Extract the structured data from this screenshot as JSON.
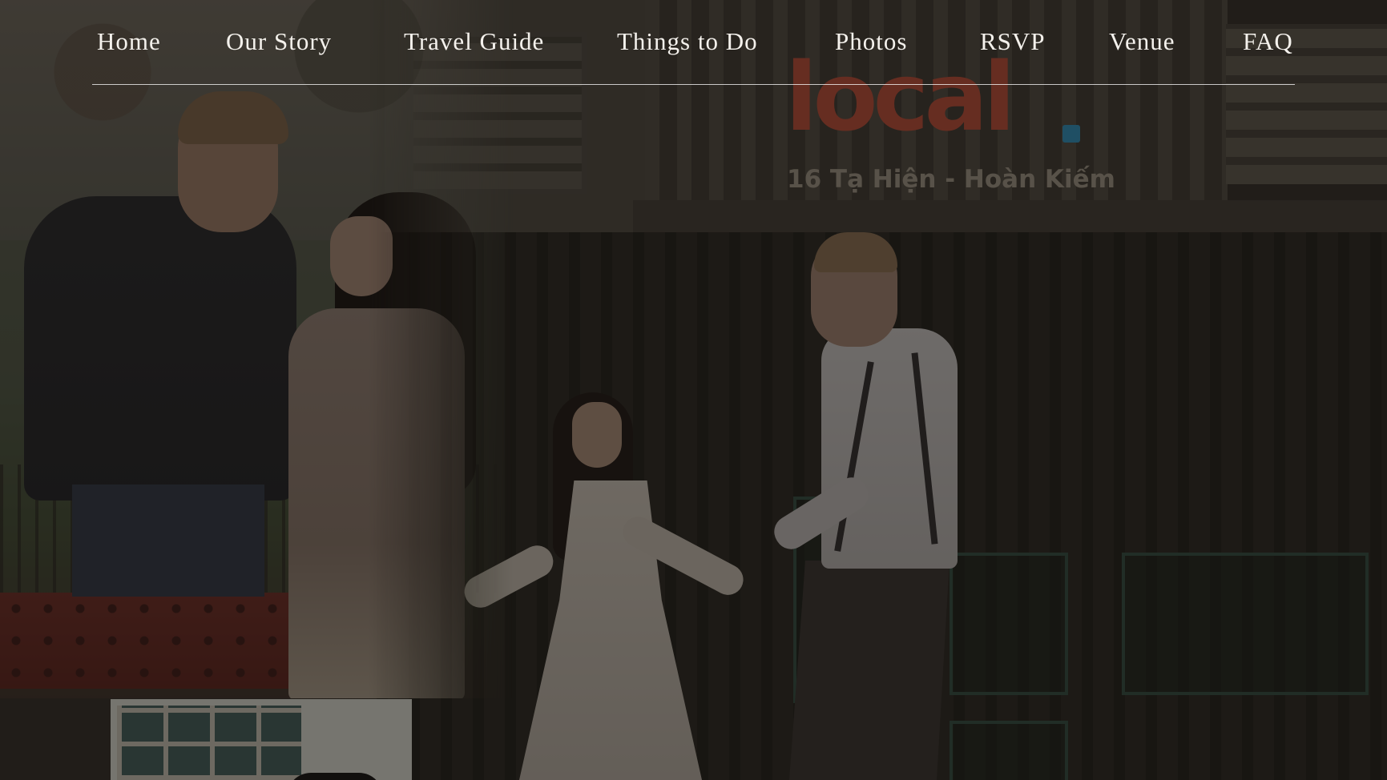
{
  "nav": {
    "items": [
      {
        "label": "Home"
      },
      {
        "label": "Our Story"
      },
      {
        "label": "Travel Guide"
      },
      {
        "label": "Things to Do"
      },
      {
        "label": "Photos"
      },
      {
        "label": "RSVP"
      },
      {
        "label": "Venue"
      },
      {
        "label": "FAQ"
      }
    ]
  },
  "hero": {
    "sign_word": "local",
    "sign_address": "16 Tạ Hiện - Hoàn Kiếm"
  },
  "colors": {
    "sign_red": "#b94a36",
    "sign_dot_blue": "#2a8fbd",
    "nav_text": "#f4f1ec"
  }
}
